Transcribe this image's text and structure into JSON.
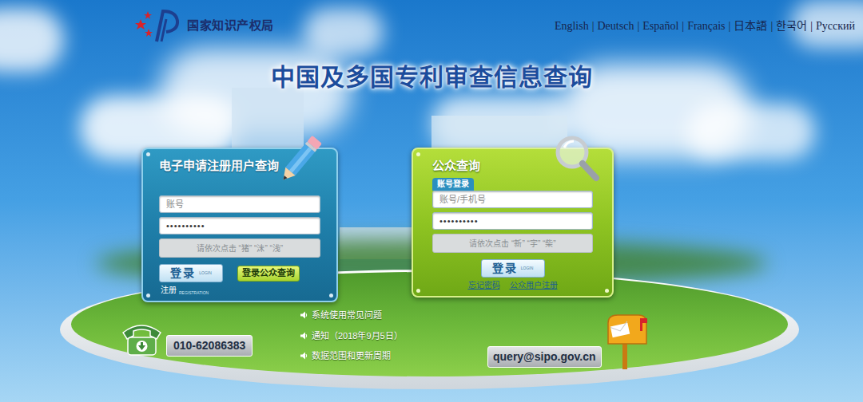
{
  "logo": {
    "text": "国家知识产权局"
  },
  "languages": {
    "separator": "|",
    "items": [
      "English",
      "Deutsch",
      "Español",
      "Français",
      "日本語",
      "한국어",
      "Русский"
    ]
  },
  "title": "中国及多国专利审查信息查询",
  "registered_panel": {
    "title": "电子申请注册用户查询",
    "account_placeholder": "账号",
    "password_value": "••••••••••",
    "captcha_prompt": "请依次点击 “猪” “沫” “浅”",
    "login_button": {
      "label": "登录",
      "sub": "LOGIN"
    },
    "public_button": "登录公众查询",
    "register_link": {
      "label": "注册",
      "sub": "REGISTRATION"
    }
  },
  "public_panel": {
    "title": "公众查询",
    "tabs": [
      {
        "label": "账号登录",
        "selected": true
      }
    ],
    "account_placeholder": "账号/手机号",
    "password_value": "••••••••••",
    "captcha_prompt": "请依次点击 “新” “宇” “柴”",
    "login_button": {
      "label": "登录",
      "sub": "LOGIN"
    },
    "links": [
      "忘记密码",
      "公众用户注册"
    ]
  },
  "notices": [
    "系统使用常见问题",
    "通知（2018年9月5日）",
    "数据范围和更新周期"
  ],
  "phone": "010-62086383",
  "email": "query@sipo.gov.cn"
}
